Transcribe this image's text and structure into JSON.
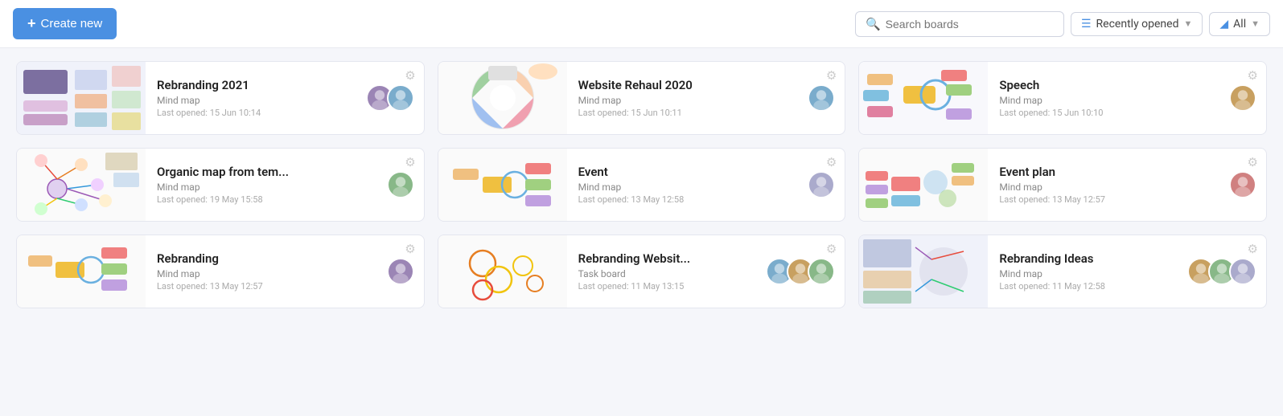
{
  "toolbar": {
    "create_label": "Create new",
    "search_placeholder": "Search boards",
    "recently_opened_label": "Recently opened",
    "filter_label": "All"
  },
  "boards": [
    {
      "id": 1,
      "title": "Rebranding 2021",
      "type": "Mind map",
      "last_opened": "Last opened: 15 Jun 10:14",
      "thumb_type": "rebranding2021",
      "avatars": 2
    },
    {
      "id": 2,
      "title": "Website Rehaul 2020",
      "type": "Mind map",
      "last_opened": "Last opened: 15 Jun 10:11",
      "thumb_type": "website_rehaul",
      "avatars": 1
    },
    {
      "id": 3,
      "title": "Speech",
      "type": "Mind map",
      "last_opened": "Last opened: 15 Jun 10:10",
      "thumb_type": "speech",
      "avatars": 1
    },
    {
      "id": 4,
      "title": "Organic map from tem...",
      "type": "Mind map",
      "last_opened": "Last opened: 19 May 15:58",
      "thumb_type": "organic",
      "avatars": 1
    },
    {
      "id": 5,
      "title": "Event",
      "type": "Mind map",
      "last_opened": "Last opened: 13 May 12:58",
      "thumb_type": "event",
      "avatars": 1
    },
    {
      "id": 6,
      "title": "Event plan",
      "type": "Mind map",
      "last_opened": "Last opened: 13 May 12:57",
      "thumb_type": "event_plan",
      "avatars": 1
    },
    {
      "id": 7,
      "title": "Rebranding",
      "type": "Mind map",
      "last_opened": "Last opened: 13 May 12:57",
      "thumb_type": "rebranding",
      "avatars": 1
    },
    {
      "id": 8,
      "title": "Rebranding Websit...",
      "type": "Task board",
      "last_opened": "Last opened: 11 May 13:15",
      "thumb_type": "rebranding_website",
      "avatars": 3
    },
    {
      "id": 9,
      "title": "Rebranding Ideas",
      "type": "Mind map",
      "last_opened": "Last opened: 11 May 12:58",
      "thumb_type": "rebranding_ideas",
      "avatars": 3
    }
  ]
}
